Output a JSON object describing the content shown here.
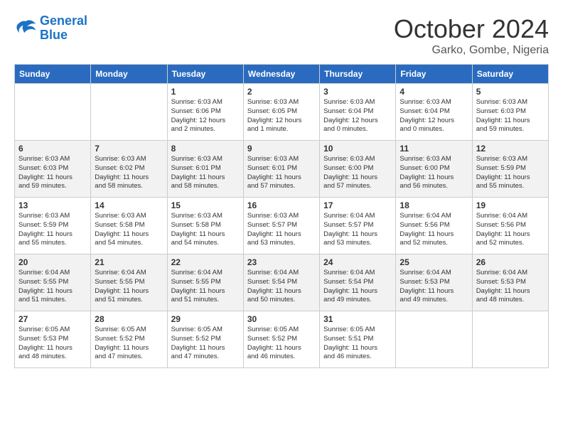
{
  "header": {
    "logo_line1": "General",
    "logo_line2": "Blue",
    "month": "October 2024",
    "location": "Garko, Gombe, Nigeria"
  },
  "days_of_week": [
    "Sunday",
    "Monday",
    "Tuesday",
    "Wednesday",
    "Thursday",
    "Friday",
    "Saturday"
  ],
  "weeks": [
    [
      {
        "day": "",
        "text": ""
      },
      {
        "day": "",
        "text": ""
      },
      {
        "day": "1",
        "text": "Sunrise: 6:03 AM\nSunset: 6:06 PM\nDaylight: 12 hours\nand 2 minutes."
      },
      {
        "day": "2",
        "text": "Sunrise: 6:03 AM\nSunset: 6:05 PM\nDaylight: 12 hours\nand 1 minute."
      },
      {
        "day": "3",
        "text": "Sunrise: 6:03 AM\nSunset: 6:04 PM\nDaylight: 12 hours\nand 0 minutes."
      },
      {
        "day": "4",
        "text": "Sunrise: 6:03 AM\nSunset: 6:04 PM\nDaylight: 12 hours\nand 0 minutes."
      },
      {
        "day": "5",
        "text": "Sunrise: 6:03 AM\nSunset: 6:03 PM\nDaylight: 11 hours\nand 59 minutes."
      }
    ],
    [
      {
        "day": "6",
        "text": "Sunrise: 6:03 AM\nSunset: 6:03 PM\nDaylight: 11 hours\nand 59 minutes."
      },
      {
        "day": "7",
        "text": "Sunrise: 6:03 AM\nSunset: 6:02 PM\nDaylight: 11 hours\nand 58 minutes."
      },
      {
        "day": "8",
        "text": "Sunrise: 6:03 AM\nSunset: 6:01 PM\nDaylight: 11 hours\nand 58 minutes."
      },
      {
        "day": "9",
        "text": "Sunrise: 6:03 AM\nSunset: 6:01 PM\nDaylight: 11 hours\nand 57 minutes."
      },
      {
        "day": "10",
        "text": "Sunrise: 6:03 AM\nSunset: 6:00 PM\nDaylight: 11 hours\nand 57 minutes."
      },
      {
        "day": "11",
        "text": "Sunrise: 6:03 AM\nSunset: 6:00 PM\nDaylight: 11 hours\nand 56 minutes."
      },
      {
        "day": "12",
        "text": "Sunrise: 6:03 AM\nSunset: 5:59 PM\nDaylight: 11 hours\nand 55 minutes."
      }
    ],
    [
      {
        "day": "13",
        "text": "Sunrise: 6:03 AM\nSunset: 5:59 PM\nDaylight: 11 hours\nand 55 minutes."
      },
      {
        "day": "14",
        "text": "Sunrise: 6:03 AM\nSunset: 5:58 PM\nDaylight: 11 hours\nand 54 minutes."
      },
      {
        "day": "15",
        "text": "Sunrise: 6:03 AM\nSunset: 5:58 PM\nDaylight: 11 hours\nand 54 minutes."
      },
      {
        "day": "16",
        "text": "Sunrise: 6:03 AM\nSunset: 5:57 PM\nDaylight: 11 hours\nand 53 minutes."
      },
      {
        "day": "17",
        "text": "Sunrise: 6:04 AM\nSunset: 5:57 PM\nDaylight: 11 hours\nand 53 minutes."
      },
      {
        "day": "18",
        "text": "Sunrise: 6:04 AM\nSunset: 5:56 PM\nDaylight: 11 hours\nand 52 minutes."
      },
      {
        "day": "19",
        "text": "Sunrise: 6:04 AM\nSunset: 5:56 PM\nDaylight: 11 hours\nand 52 minutes."
      }
    ],
    [
      {
        "day": "20",
        "text": "Sunrise: 6:04 AM\nSunset: 5:55 PM\nDaylight: 11 hours\nand 51 minutes."
      },
      {
        "day": "21",
        "text": "Sunrise: 6:04 AM\nSunset: 5:55 PM\nDaylight: 11 hours\nand 51 minutes."
      },
      {
        "day": "22",
        "text": "Sunrise: 6:04 AM\nSunset: 5:55 PM\nDaylight: 11 hours\nand 51 minutes."
      },
      {
        "day": "23",
        "text": "Sunrise: 6:04 AM\nSunset: 5:54 PM\nDaylight: 11 hours\nand 50 minutes."
      },
      {
        "day": "24",
        "text": "Sunrise: 6:04 AM\nSunset: 5:54 PM\nDaylight: 11 hours\nand 49 minutes."
      },
      {
        "day": "25",
        "text": "Sunrise: 6:04 AM\nSunset: 5:53 PM\nDaylight: 11 hours\nand 49 minutes."
      },
      {
        "day": "26",
        "text": "Sunrise: 6:04 AM\nSunset: 5:53 PM\nDaylight: 11 hours\nand 48 minutes."
      }
    ],
    [
      {
        "day": "27",
        "text": "Sunrise: 6:05 AM\nSunset: 5:53 PM\nDaylight: 11 hours\nand 48 minutes."
      },
      {
        "day": "28",
        "text": "Sunrise: 6:05 AM\nSunset: 5:52 PM\nDaylight: 11 hours\nand 47 minutes."
      },
      {
        "day": "29",
        "text": "Sunrise: 6:05 AM\nSunset: 5:52 PM\nDaylight: 11 hours\nand 47 minutes."
      },
      {
        "day": "30",
        "text": "Sunrise: 6:05 AM\nSunset: 5:52 PM\nDaylight: 11 hours\nand 46 minutes."
      },
      {
        "day": "31",
        "text": "Sunrise: 6:05 AM\nSunset: 5:51 PM\nDaylight: 11 hours\nand 46 minutes."
      },
      {
        "day": "",
        "text": ""
      },
      {
        "day": "",
        "text": ""
      }
    ]
  ]
}
